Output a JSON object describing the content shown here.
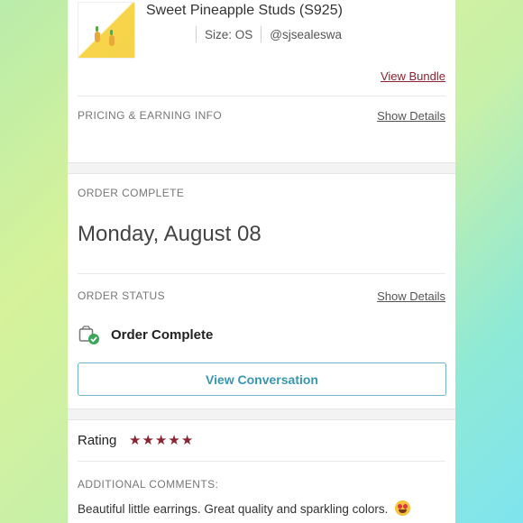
{
  "item": {
    "title": "Sweet Pineapple Studs (S925)",
    "size": "Size: OS",
    "seller": "@sjsealeswa",
    "view_bundle": "View Bundle"
  },
  "pricing": {
    "label": "PRICING & EARNING INFO",
    "show_details": "Show Details"
  },
  "order_complete": {
    "label": "ORDER COMPLETE",
    "date": "Monday, August 08"
  },
  "order_status": {
    "label": "ORDER STATUS",
    "show_details": "Show Details",
    "status": "Order Complete",
    "icon": "package-check-icon"
  },
  "conversation": {
    "button_label": "View Conversation"
  },
  "rating": {
    "label": "Rating",
    "stars": 5,
    "star_glyph": "★"
  },
  "comments": {
    "label": "ADDITIONAL COMMENTS:",
    "text": "Beautiful little earrings. Great quality and sparkling colors."
  },
  "colors": {
    "accent_red": "#8b2331",
    "button_blue": "#3797b2",
    "success_green": "#3aa65a"
  }
}
